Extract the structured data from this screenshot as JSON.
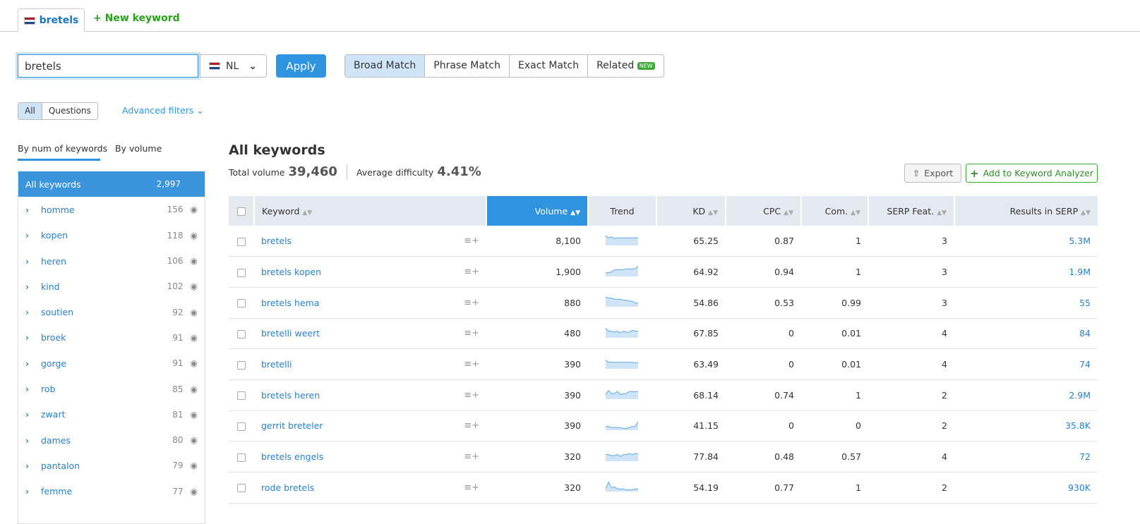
{
  "tabs": {
    "active": "bretels",
    "new_keyword": "New keyword"
  },
  "search": {
    "value": "bretels",
    "database": "NL",
    "apply": "Apply"
  },
  "match": [
    {
      "label": "Broad Match",
      "active": true
    },
    {
      "label": "Phrase Match"
    },
    {
      "label": "Exact Match"
    },
    {
      "label": "Related",
      "badge": "NEW"
    }
  ],
  "filters": {
    "all": "All",
    "questions": "Questions",
    "advanced": "Advanced filters"
  },
  "sidebar": {
    "tab_num": "By num of keywords",
    "tab_volume": "By volume",
    "all": {
      "label": "All keywords",
      "count": "2,997"
    },
    "groups": [
      [
        "homme",
        "156"
      ],
      [
        "kopen",
        "118"
      ],
      [
        "heren",
        "106"
      ],
      [
        "kind",
        "102"
      ],
      [
        "soutien",
        "92"
      ],
      [
        "broek",
        "91"
      ],
      [
        "gorge",
        "91"
      ],
      [
        "rob",
        "85"
      ],
      [
        "zwart",
        "81"
      ],
      [
        "dames",
        "80"
      ],
      [
        "pantalon",
        "79"
      ],
      [
        "femme",
        "77"
      ]
    ]
  },
  "main": {
    "title": "All keywords",
    "total_label": "Total volume",
    "total": "39,460",
    "diff_label": "Average difficulty",
    "diff": "4.41%",
    "export": "Export",
    "add": "Add to Keyword Analyzer"
  },
  "table": {
    "headers": [
      "Keyword",
      "Volume",
      "Trend",
      "KD",
      "CPC",
      "Com.",
      "SERP Feat.",
      "Results in SERP"
    ],
    "rows": [
      {
        "kw": "bretels",
        "vol": "8,100",
        "kd": "65.25",
        "cpc": "0.87",
        "com": "1",
        "serp": "3",
        "res": "5.3M",
        "trend": [
          9,
          7,
          8,
          6,
          7,
          7,
          7,
          7,
          7,
          7,
          7,
          7
        ]
      },
      {
        "kw": "bretels kopen",
        "vol": "1,900",
        "kd": "64.92",
        "cpc": "0.94",
        "com": "1",
        "serp": "3",
        "res": "1.9M",
        "trend": [
          3,
          3,
          4,
          6,
          6,
          6,
          6,
          7,
          7,
          7,
          7,
          10
        ]
      },
      {
        "kw": "bretels hema",
        "vol": "880",
        "kd": "54.86",
        "cpc": "0.53",
        "com": "0.99",
        "serp": "3",
        "res": "55",
        "trend": [
          9,
          8,
          8,
          7,
          7,
          7,
          6,
          6,
          5,
          5,
          3,
          3
        ]
      },
      {
        "kw": "bretelli weert",
        "vol": "480",
        "kd": "67.85",
        "cpc": "0",
        "com": "0.01",
        "serp": "4",
        "res": "84",
        "trend": [
          9,
          6,
          6,
          5,
          6,
          4,
          6,
          5,
          5,
          7,
          6,
          6
        ]
      },
      {
        "kw": "bretelli",
        "vol": "390",
        "kd": "63.49",
        "cpc": "0",
        "com": "0.01",
        "serp": "4",
        "res": "74",
        "trend": [
          8,
          6,
          6,
          6,
          6,
          6,
          6,
          6,
          6,
          6,
          5,
          6
        ]
      },
      {
        "kw": "bretels heren",
        "vol": "390",
        "kd": "68.14",
        "cpc": "0.74",
        "com": "1",
        "serp": "2",
        "res": "2.9M",
        "trend": [
          4,
          8,
          5,
          5,
          7,
          4,
          5,
          5,
          7,
          7,
          7,
          7
        ]
      },
      {
        "kw": "gerrit breteler",
        "vol": "390",
        "kd": "41.15",
        "cpc": "0",
        "com": "0",
        "serp": "2",
        "res": "35.8K",
        "trend": [
          3,
          3,
          2,
          2,
          2,
          2,
          1,
          1,
          2,
          3,
          3,
          8
        ]
      },
      {
        "kw": "bretels engels",
        "vol": "320",
        "kd": "77.84",
        "cpc": "0.48",
        "com": "0.57",
        "serp": "4",
        "res": "72",
        "trend": [
          6,
          6,
          5,
          5,
          6,
          4,
          6,
          6,
          7,
          6,
          7,
          7
        ]
      },
      {
        "kw": "rode bretels",
        "vol": "320",
        "kd": "54.19",
        "cpc": "0.77",
        "com": "1",
        "serp": "2",
        "res": "930K",
        "trend": [
          2,
          9,
          3,
          4,
          2,
          2,
          2,
          1,
          1,
          1,
          2,
          2
        ]
      }
    ]
  },
  "colors": {
    "accent": "#2f94e0",
    "green": "#3aaa35",
    "header": "#e3e9ef"
  }
}
